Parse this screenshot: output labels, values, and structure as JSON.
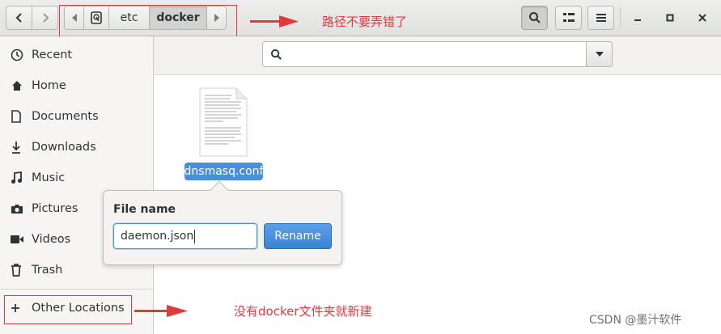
{
  "header": {
    "nav": {
      "back_icon": "chevron-left-icon",
      "forward_icon": "chevron-right-icon"
    },
    "path": {
      "left_scroll_icon": "triangle-left-icon",
      "root_icon": "drive-icon",
      "segments": [
        "etc",
        "docker"
      ],
      "right_scroll_icon": "triangle-right-icon"
    },
    "buttons": {
      "search_icon": "search-icon",
      "view_icon": "grid-view-icon",
      "menu_icon": "hamburger-menu-icon"
    },
    "window_controls": {
      "minimize_icon": "minimize-icon",
      "maximize_icon": "maximize-icon",
      "close_icon": "close-icon"
    }
  },
  "annotations": {
    "path_note": "路径不要弄错了",
    "location_note": "没有docker文件夹就新建",
    "color": "#e0393e"
  },
  "sidebar": {
    "items": [
      {
        "label": "Recent",
        "icon": "clock-icon"
      },
      {
        "label": "Home",
        "icon": "home-icon"
      },
      {
        "label": "Documents",
        "icon": "document-icon"
      },
      {
        "label": "Downloads",
        "icon": "download-icon"
      },
      {
        "label": "Music",
        "icon": "music-icon"
      },
      {
        "label": "Pictures",
        "icon": "camera-icon"
      },
      {
        "label": "Videos",
        "icon": "video-icon"
      },
      {
        "label": "Trash",
        "icon": "trash-icon"
      }
    ],
    "other_locations": {
      "label": "Other Locations",
      "icon": "plus-icon"
    }
  },
  "search": {
    "placeholder": "",
    "icon": "search-icon",
    "dropdown_icon": "chevron-down-icon"
  },
  "files": [
    {
      "name": "dnsmasq.conf",
      "icon": "text-file-icon",
      "selected": true
    }
  ],
  "rename_popover": {
    "title": "File name",
    "value": "daemon.json",
    "button_label": "Rename"
  },
  "watermark": "CSDN @墨汁软件",
  "colors": {
    "selection": "#4a90d9",
    "accent_button": "#3b84d3"
  }
}
